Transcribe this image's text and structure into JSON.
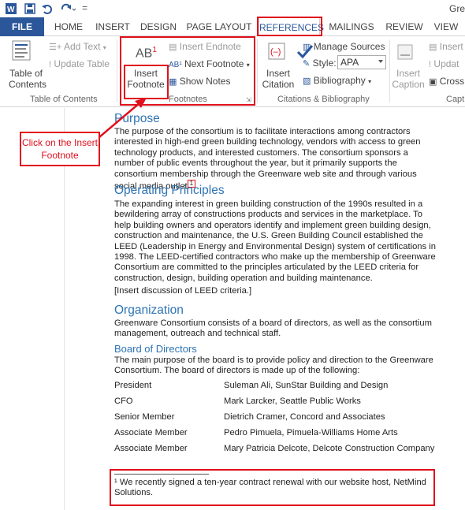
{
  "window": {
    "title_fragment": "Gre"
  },
  "tabs": [
    "FILE",
    "HOME",
    "INSERT",
    "DESIGN",
    "PAGE LAYOUT",
    "REFERENCES",
    "MAILINGS",
    "REVIEW",
    "VIEW"
  ],
  "ribbon": {
    "toc": {
      "label_line1": "Table of",
      "label_line2": "Contents",
      "add_text": "Add Text",
      "update_table": "Update Table",
      "group": "Table of Contents"
    },
    "footnotes": {
      "insert_line1": "Insert",
      "insert_line2": "Footnote",
      "insert_endnote": "Insert Endnote",
      "next_footnote": "Next Footnote",
      "show_notes": "Show Notes",
      "group": "Footnotes",
      "ab_glyph": "AB",
      "ab_sup": "1"
    },
    "citations": {
      "insert_line1": "Insert",
      "insert_line2": "Citation",
      "manage_sources": "Manage Sources",
      "style_label": "Style:",
      "style_value": "APA",
      "bibliography": "Bibliography",
      "group": "Citations & Bibliography"
    },
    "captions": {
      "insert_line1": "Insert",
      "insert_line2": "Caption",
      "insert_tof": "Insert",
      "update": "Updat",
      "cross": "Cross",
      "group": "Capti"
    }
  },
  "callout": {
    "text": "Click on the Insert Footnote"
  },
  "document": {
    "purpose_heading": "Purpose",
    "purpose_text": "The purpose of the consortium is to facilitate interactions among contractors interested in high-end green building technology, vendors with access to green technology products, and interested customers. The consortium sponsors a number of public events throughout the year, but it primarily supports the consortium membership through the Greenware web site and through various social media outlet",
    "footnote_ref": "1",
    "principles_heading": "Operating Principles",
    "principles_text": "The expanding interest in green building construction of the 1990s resulted in a bewildering array of constructions products and services in the marketplace. To help building owners and operators identify and implement green building design, construction and maintenance, the U.S. Green Building Council established the LEED (Leadership in Energy and Environmental Design) system of certifications in 1998. The LEED-certified contractors who make up the membership of Greenware Consortium are committed to the principles articulated by the LEED criteria for construction, design, building operation and building maintenance.",
    "insert_note": "[Insert discussion of LEED criteria.]",
    "org_heading": "Organization",
    "org_text": "Greenware Consortium consists of a board of directors, as well as the consortium management, outreach and technical staff.",
    "board_heading": "Board of Directors",
    "board_text": "The main purpose of the board is to provide policy and direction to the Greenware Consortium. The board of directors is made up of the following:",
    "board_rows": [
      {
        "role": "President",
        "name": "Suleman Ali, SunStar Building and Design"
      },
      {
        "role": "CFO",
        "name": "Mark Larcker, Seattle Public Works"
      },
      {
        "role": "Senior Member",
        "name": "Dietrich Cramer, Concord and Associates"
      },
      {
        "role": "Associate Member",
        "name": "Pedro Pimuela, Pimuela-Williams Home Arts"
      },
      {
        "role": "Associate Member",
        "name": "Mary Patricia Delcote, Delcote Construction Company"
      }
    ],
    "footnote_text": "¹ We recently signed a ten-year contract renewal with our website host, NetMind Solutions."
  },
  "colors": {
    "accent": "#2b579a",
    "heading": "#2e74b5",
    "annotation": "#e0101c"
  },
  "icons": [
    "save-icon",
    "undo-icon",
    "redo-icon",
    "table-of-contents-icon",
    "insert-footnote-icon",
    "insert-citation-icon",
    "manage-sources-icon",
    "bibliography-icon",
    "insert-caption-icon"
  ]
}
